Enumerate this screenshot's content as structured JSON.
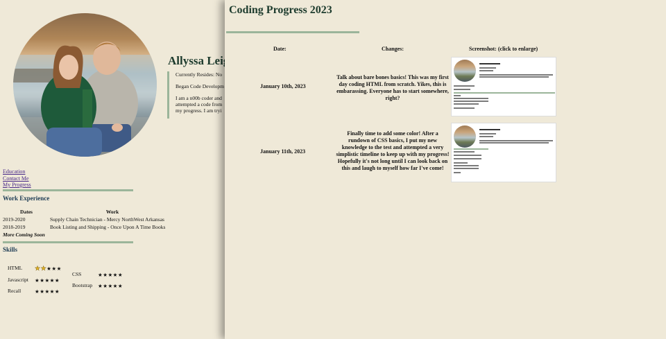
{
  "profile": {
    "name": "Allyssa Leig",
    "bio_residence": "Currently Resides: No",
    "bio_began": "Began Code Developm",
    "bio_lines": [
      "I am a n00b coder and",
      "attempted a code from",
      "my progress. I am tryi"
    ]
  },
  "nav": {
    "links": [
      "Education",
      "Contact Me",
      "My Progress"
    ]
  },
  "work": {
    "title": "Work Experience",
    "headers": [
      "Dates",
      "Work"
    ],
    "rows": [
      [
        "2019-2020",
        "Supply Chain Technician - Mercy NorthWest Arkansas"
      ],
      [
        "2018-2019",
        "Book Listing and Shipping - Once Upon A Time Books"
      ]
    ],
    "more": "More Coming Soon"
  },
  "skills": {
    "title": "Skills",
    "items": [
      {
        "label": "HTML",
        "filled": 2,
        "total": 5
      },
      {
        "label": "Javascript",
        "filled": 0,
        "total": 5
      },
      {
        "label": "Recall",
        "filled": 0,
        "total": 5
      },
      {
        "label": "CSS",
        "filled": 0,
        "total": 5
      },
      {
        "label": "Bootstrap",
        "filled": 0,
        "total": 5
      }
    ]
  },
  "panel": {
    "title": "Coding Progress 2023",
    "headers": [
      "Date:",
      "Changes:",
      "Screenshot: (click to enlarge)"
    ],
    "rows": [
      {
        "date": "January 10th, 2023",
        "changes": "Talk about bare bones basics! This was my first day coding HTML from scratch. Yikes, this is embarassing. Everyone has to start somewhere, right?"
      },
      {
        "date": "January 11th, 2023",
        "changes": "Finally time to add some color! After a rundown of CSS basics, I put my new knowledge to the test and attempted a very simplistic timeline to keep up with my progress! Hopefully it's not long until I can look back on this and laugh to myself how far I've come!"
      }
    ]
  },
  "colors": {
    "background": "#efe9d8",
    "accent_green": "#9bb59a",
    "heading": "#1d3b2d",
    "link": "#4a2b8a",
    "star": "#e8b824"
  }
}
